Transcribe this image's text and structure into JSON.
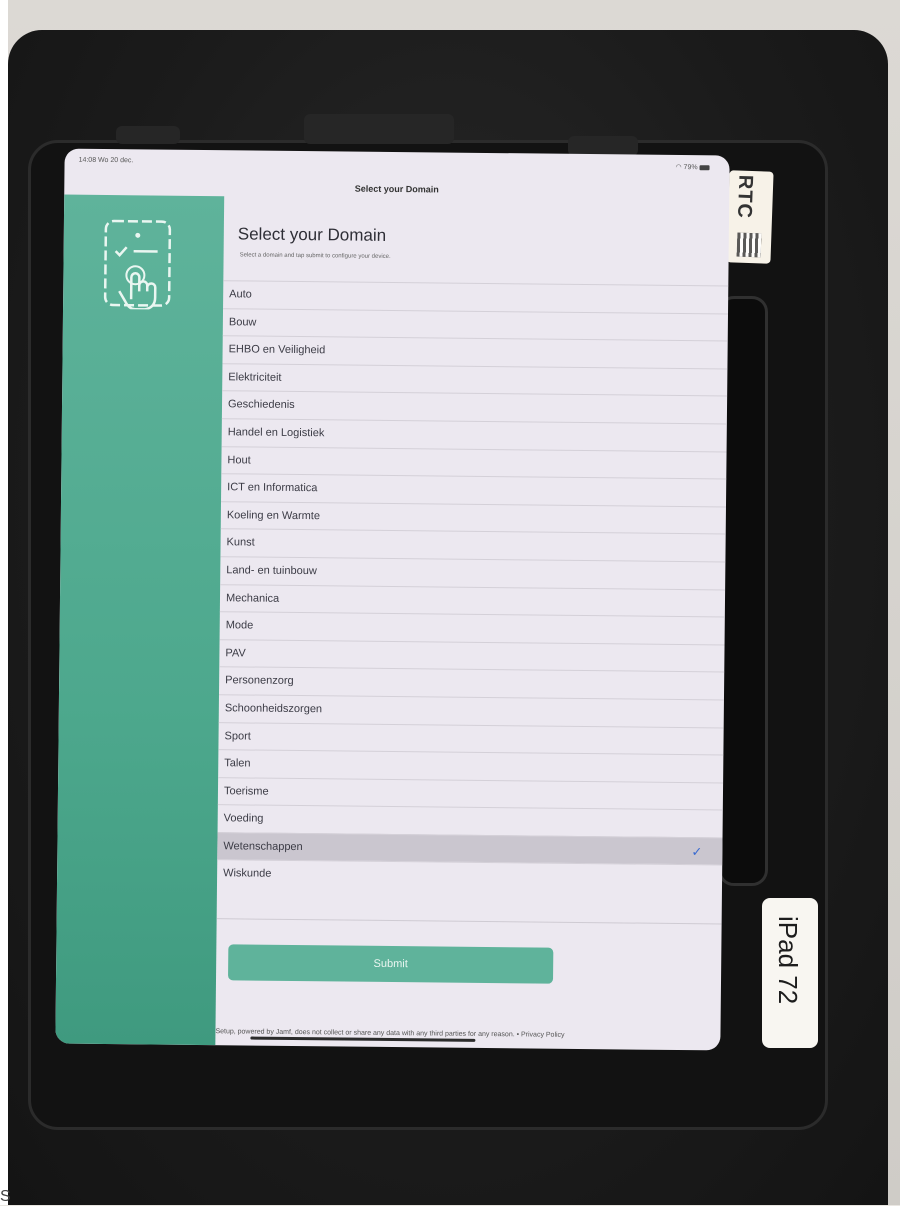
{
  "status_bar": {
    "time_date": "14:08 Wo 20 dec.",
    "right": "79%"
  },
  "nav": {
    "title": "Select your Domain"
  },
  "main": {
    "heading": "Select your Domain",
    "subheading": "Select a domain and tap submit to configure your device.",
    "domains": [
      "Auto",
      "Bouw",
      "EHBO en Veiligheid",
      "Elektriciteit",
      "Geschiedenis",
      "Handel en Logistiek",
      "Hout",
      "ICT en Informatica",
      "Koeling en Warmte",
      "Kunst",
      "Land- en tuinbouw",
      "Mechanica",
      "Mode",
      "PAV",
      "Personenzorg",
      "Schoonheidszorgen",
      "Sport",
      "Talen",
      "Toerisme",
      "Voeding",
      "Wetenschappen",
      "Wiskunde"
    ],
    "selected_index": 20,
    "checkmark": "✓",
    "submit_label": "Submit",
    "disclaimer": "Setup, powered by Jamf, does not collect or share any data with any third parties for any reason. • Privacy Policy"
  },
  "case": {
    "sticker_top": "RTC",
    "sticker_side": "iPad 72",
    "corner_glyph": "S"
  },
  "colors": {
    "accent_green": "#5fb39b",
    "checkmark_blue": "#3a6bd0"
  }
}
